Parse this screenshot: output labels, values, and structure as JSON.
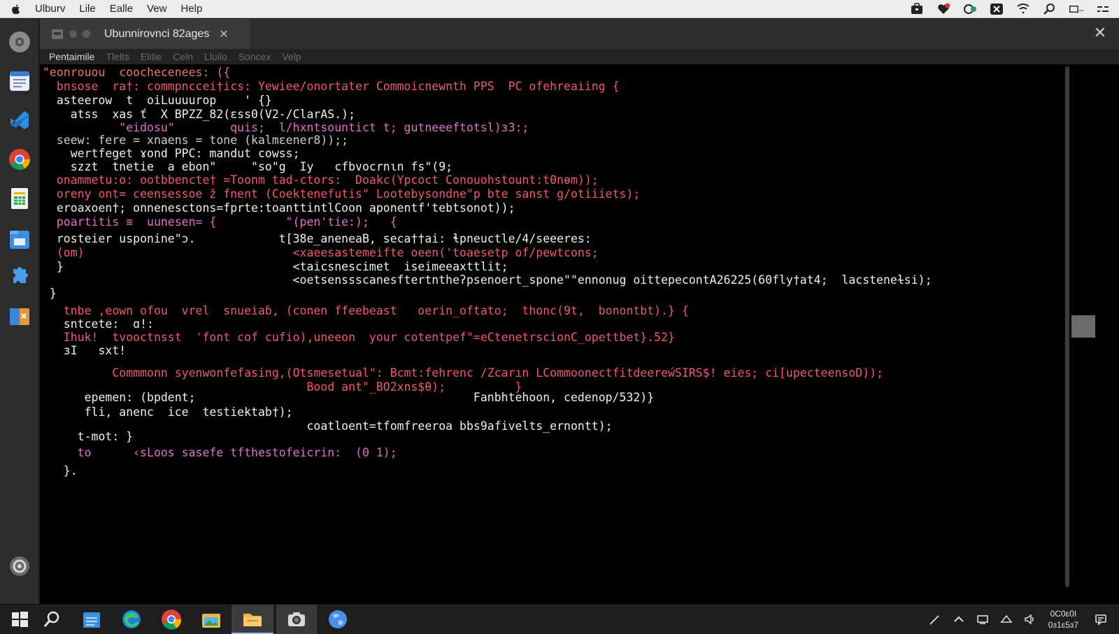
{
  "menubar": {
    "items": [
      "Ulburv",
      "Lile",
      "Ealle",
      "Vew",
      "Help"
    ]
  },
  "window": {
    "tab_title": "Ubunnirovnci 82ages",
    "tab_close": "✕",
    "close": "✕"
  },
  "terminal_menu": {
    "items": [
      "Pentaimile",
      "Tlelts",
      "Elitie",
      "Celn",
      "Lluilo",
      "Soncex",
      "Velp"
    ]
  },
  "terminal": {
    "lines": [
      {
        "text": "\"eonrouou  coochecenees: ({",
        "color": "#e8766f"
      },
      {
        "text": "  bnsose  ra†: commpnccei†ics: Yewiee/onortater Commoicnewnth PPS  PC ofehreaiing {",
        "color": "#ee5a74"
      },
      {
        "text": "  asteerow  t  oiLuuuurop    ' {}",
        "color": "#f0f0f0"
      },
      {
        "text": "    atss  xas ť  X BPZZ_82(ɛss0(V2-/ClarAS.);",
        "color": "#f0f0f0"
      },
      {
        "text": "           \"eidosu\"        quis;  l/hxntsountict t; gutneeeftotsl)ɜ3:;",
        "color": "#e070c8"
      },
      {
        "text": "  seew: fere = xnaens = tone (kalmɛener8));;",
        "color": "#cfcfcf"
      },
      {
        "text": "    wertfeget ɤond PPC: mandut cowss;",
        "color": "#f0f0f0"
      },
      {
        "text": "    szzt  tnetie  a ebon\"     \"so\"g  Iy   cfbvocrnɩn fs\"(9;",
        "color": "#f0f0f0"
      },
      {
        "text": "  onammetu:o: ootbbencte† =Toonm tad-ctors:  Doakc(Ypcoct Conouohstount:t0nɵm));",
        "color": "#ee5a74"
      },
      {
        "text": "  oreny ont= ceensessoe ž fnent (Coektenefutis\" Lootebysondne\"p bte sanst g/otiiiets);",
        "color": "#ee5a74"
      },
      {
        "text": "  eroaxoen†; onnenesctons=fprte:toanttintlCoon aponentf'tebtsonot));",
        "color": "#f0f0f0"
      },
      {
        "text": "  poartitis ≡  uunesen= {          \"(pen'tie:);   {",
        "color": "#e070c8"
      },
      {
        "text": "  rosteier usponine\"ɔ.            t[38e_aneneaB, seca††ai: ɬpneuctle/4/seeeres:",
        "color": "#f0f0f0"
      },
      {
        "text": "  (om)                              <xaeesastemeifte oeen('toaesetp of/pewtcons;",
        "color": "#ee5a74"
      },
      {
        "text": "  }                                 <taicsnescimet  iseimeeaxttlit;",
        "color": "#f0f0f0"
      },
      {
        "text": "                                    <oetsenssscanesftertntheʔpsenoert_spone\"\"ennonug oittepecontA26225(60fly†at4;  lacsteneɫsi);",
        "color": "#f0f0f0"
      },
      {
        "text": " }",
        "color": "#f0f0f0"
      },
      {
        "text": "   tnbe ,eown ofou  vrel  snueiaɓ, (conen ffeebeast   oerin_oftato;  thonc(9t,  bonontbt).} {",
        "color": "#ee5a74"
      },
      {
        "text": "   sntcete:  ɑ!:",
        "color": "#f0f0f0"
      },
      {
        "text": "   Ihuk!  tvooctnsst  'font cof cufio),uneeon  your cotentpef\"=eCtenetrscionC_opettbet}.52}",
        "color": "#ee5a74"
      },
      {
        "text": "   ɜI   sxt!",
        "color": "#f0f0f0"
      },
      {
        "text": "          Commmonn syenwonfefasing,(Otsmesetual\": Bcmt:fehrenc /Zcarın LCommoonectfitdeereẃSIRS$! eies; ci[upecteensoD));",
        "color": "#ee5a74"
      },
      {
        "text": "                                      Bood ant\"_BO2xns$θ);          }",
        "color": "#ee5a74"
      },
      {
        "text": "      epemen: (bpdent;                                        Fanbhtehoon, cedenop/532)}",
        "color": "#f0f0f0"
      },
      {
        "text": "      fli, anenc  ice  testiektab†);",
        "color": "#f0f0f0"
      },
      {
        "text": "                                      coatloent=tfomfreeroa bbs9afivelts_ernontt);",
        "color": "#f0f0f0"
      },
      {
        "text": "     t-mot: }",
        "color": "#f0f0f0"
      },
      {
        "text": "     to      ‹sLoos sasefe tfthestofeicrin:  (0 1);",
        "color": "#e070c8"
      },
      {
        "text": "   }.",
        "color": "#f0f0f0"
      }
    ]
  },
  "tray": {
    "clock_line1": "0C0ɛ0I",
    "clock_line2": "0ɜ1ɛ5ɜ7"
  }
}
